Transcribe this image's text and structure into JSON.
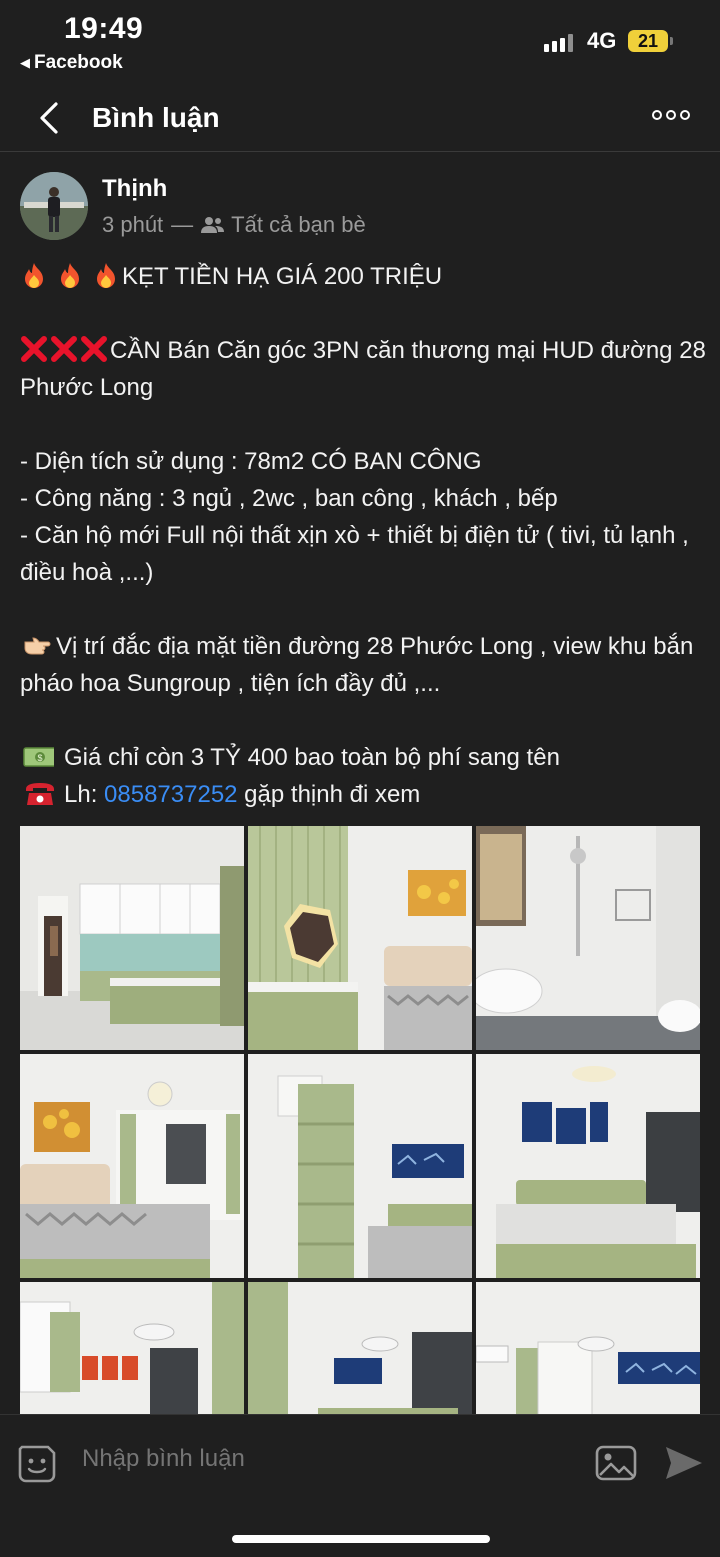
{
  "status_bar": {
    "time": "19:49",
    "back_app": "Facebook",
    "network": "4G",
    "battery": "21"
  },
  "nav": {
    "title": "Bình luận"
  },
  "post": {
    "author": "Thịnh",
    "time_ago": "3 phút",
    "audience": "Tất cả bạn bè",
    "line1": "KẸT TIỀN HẠ GIÁ 200 TRIỆU",
    "line2": "CẦN Bán Căn góc 3PN căn thương mại HUD đường 28 Phước Long",
    "line3": "- Diện tích sử dụng : 78m2 CÓ BAN CÔNG",
    "line4": "- Công năng : 3 ngủ , 2wc , ban công , khách , bếp",
    "line5": "- Căn hộ mới Full nội thất xịn xò + thiết bị điện tử ( tivi, tủ lạnh , điều hoà ,...)",
    "line6": "Vị trí đắc địa mặt tiền đường 28 Phước Long , view khu bắn pháo hoa Sungroup , tiện ích đầy đủ ,...",
    "line7": "Giá chỉ còn 3 TỶ 400 bao toàn bộ phí sang tên",
    "line8_prefix": "Lh: ",
    "phone": "0858737252",
    "line8_suffix": " gặp thịnh đi xem"
  },
  "composer": {
    "placeholder": "Nhập bình luận"
  },
  "icons": {
    "back": "chevron-left-icon",
    "more": "more-dots-icon",
    "friends": "friends-icon",
    "fire": "fire-emoji",
    "cross": "cross-mark-emoji",
    "pointing": "pointing-right-emoji",
    "money": "money-emoji",
    "telephone": "telephone-emoji",
    "sticker": "sticker-icon",
    "photo": "photo-icon",
    "send": "send-icon"
  },
  "colors": {
    "background": "#1f1f1f",
    "link": "#3a8df5",
    "muted": "#9a9a9a",
    "battery": "#f0d03a"
  }
}
